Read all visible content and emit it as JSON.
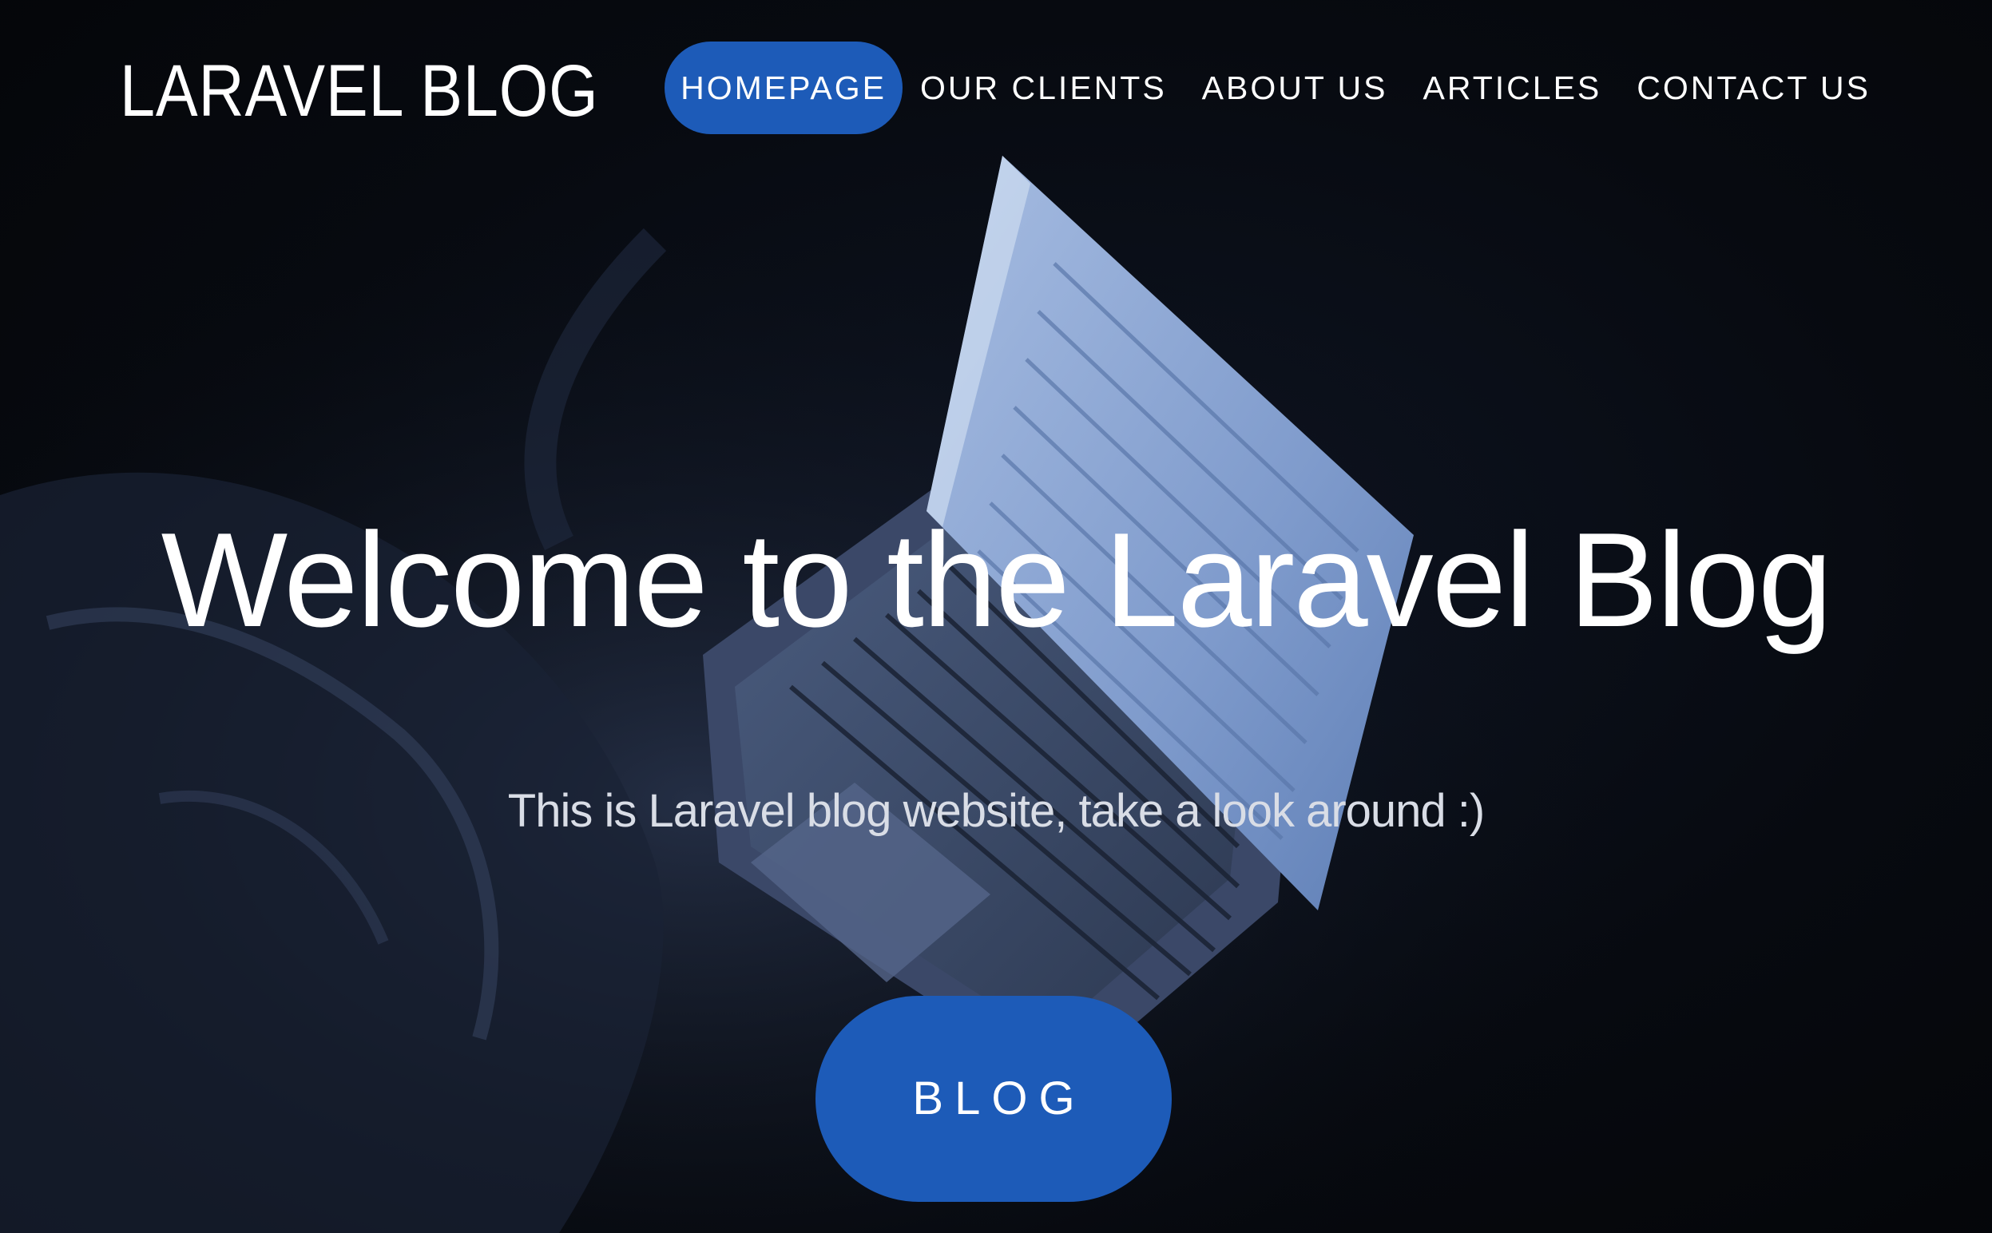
{
  "brand": {
    "logo_text": "LARAVEL BLOG"
  },
  "nav": {
    "items": [
      {
        "label": "HOMEPAGE",
        "active": true
      },
      {
        "label": "OUR CLIENTS",
        "active": false
      },
      {
        "label": "ABOUT US",
        "active": false
      },
      {
        "label": "ARTICLES",
        "active": false
      },
      {
        "label": "CONTACT US",
        "active": false
      }
    ]
  },
  "hero": {
    "headline": "Welcome to the Laravel Blog",
    "subline": "This is Laravel blog website, take a look around :)",
    "cta_label": "BLOG"
  },
  "colors": {
    "accent": "#1d5bb8",
    "background": "#06080d",
    "text": "#ffffff"
  }
}
